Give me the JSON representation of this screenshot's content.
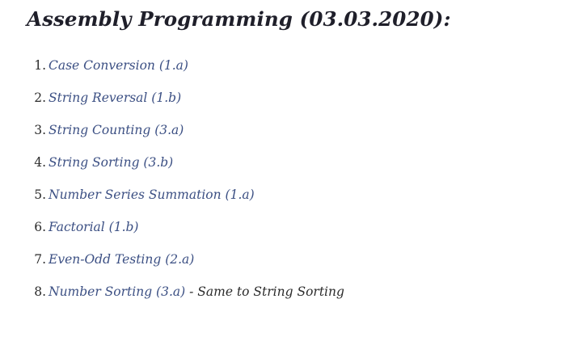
{
  "heading": "Assembly Programming (03.03.2020):",
  "items": [
    {
      "number": "1.",
      "link": "Case Conversion (1.a)",
      "note": ""
    },
    {
      "number": "2.",
      "link": "String Reversal (1.b)",
      "note": ""
    },
    {
      "number": "3.",
      "link": "String Counting (3.a)",
      "note": ""
    },
    {
      "number": "4.",
      "link": "String Sorting (3.b)",
      "note": ""
    },
    {
      "number": "5.",
      "link": "Number Series Summation (1.a)",
      "note": ""
    },
    {
      "number": "6.",
      "link": "Factorial (1.b)",
      "note": ""
    },
    {
      "number": "7.",
      "link": "Even-Odd Testing (2.a)",
      "note": ""
    },
    {
      "number": "8.",
      "link": "Number Sorting (3.a)",
      "note": " - Same to String Sorting"
    }
  ],
  "colors": {
    "link": "#3b4f83",
    "text": "#2b2b2b",
    "heading": "#1f1f2a"
  }
}
